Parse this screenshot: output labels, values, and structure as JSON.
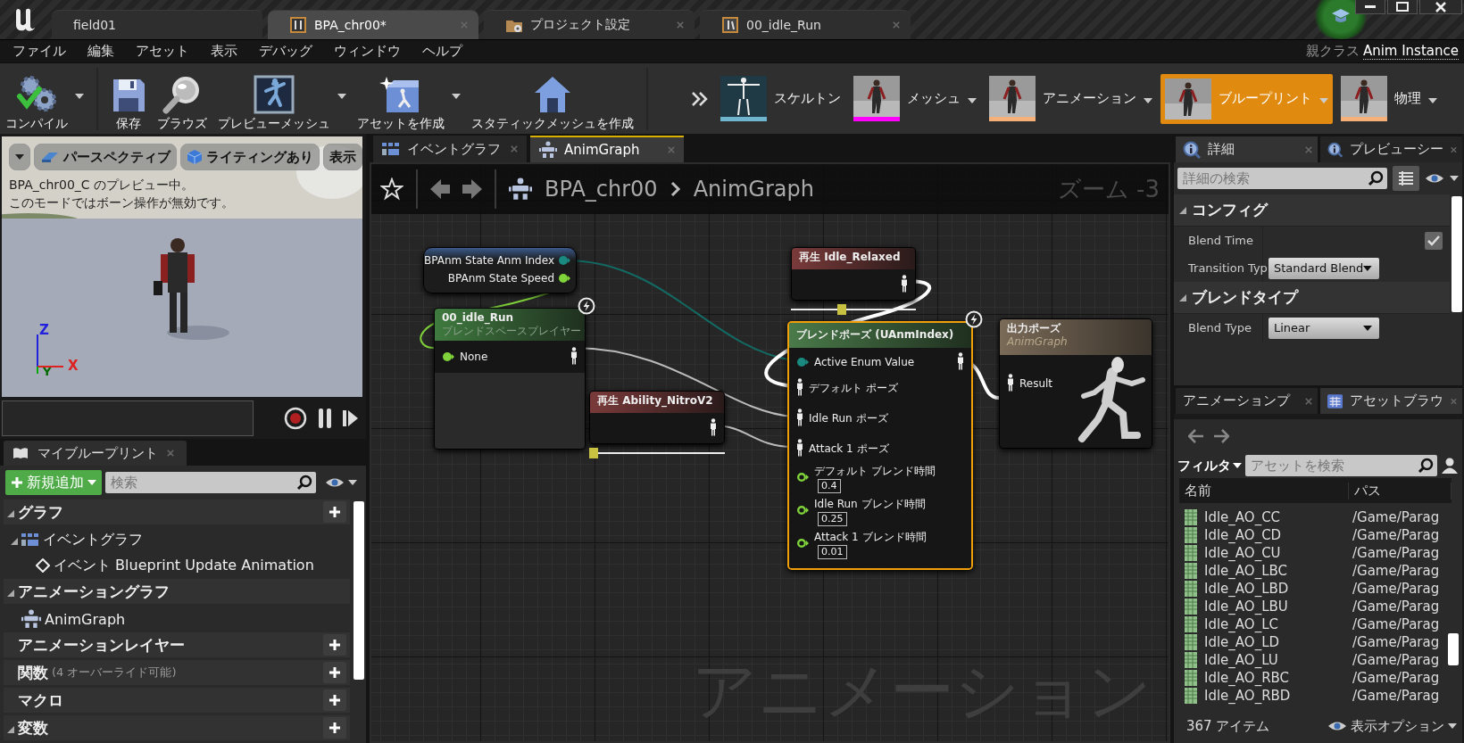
{
  "title_tabs": [
    {
      "label": "field01",
      "kind": "level",
      "selected": false
    },
    {
      "label": "BPA_chr00*",
      "kind": "blueprint",
      "selected": true
    },
    {
      "label": "プロジェクト設定",
      "kind": "settings",
      "selected": false
    },
    {
      "label": "00_idle_Run",
      "kind": "animation",
      "selected": false
    }
  ],
  "menu": [
    "ファイル",
    "編集",
    "アセット",
    "表示",
    "デバッグ",
    "ウィンドウ",
    "ヘルプ"
  ],
  "parent_class": {
    "label": "親クラス",
    "value": "Anim Instance"
  },
  "toolbar": [
    {
      "label": "コンパイル",
      "kind": "compile",
      "dropdown": true
    },
    {
      "label": "保存",
      "kind": "save",
      "dropdown": false
    },
    {
      "label": "ブラウズ",
      "kind": "browse",
      "dropdown": false
    },
    {
      "label": "プレビューメッシュ",
      "kind": "preview_mesh",
      "dropdown": true
    },
    {
      "label": "アセットを作成",
      "kind": "create_asset",
      "dropdown": true
    },
    {
      "label": "スタティックメッシュを作成",
      "kind": "static_mesh",
      "dropdown": false
    }
  ],
  "modes": [
    {
      "label": "スケルトン",
      "kind": "skeleton",
      "color": "#6fb5d0",
      "selected": false,
      "dropdown": false
    },
    {
      "label": "メッシュ",
      "kind": "mesh",
      "color": "#ff00ff",
      "selected": false,
      "dropdown": true
    },
    {
      "label": "アニメーション",
      "kind": "animation",
      "color": "#f5b07a",
      "selected": false,
      "dropdown": true
    },
    {
      "label": "ブループリント",
      "kind": "blueprint",
      "selected": true,
      "dropdown": true
    },
    {
      "label": "物理",
      "kind": "mesh",
      "color": "#f5b07a",
      "selected": false,
      "dropdown": true
    }
  ],
  "viewport": {
    "buttons": [
      {
        "label": "パースペクティブ",
        "kind": "perspective"
      },
      {
        "label": "ライティングあり",
        "kind": "lighting"
      },
      {
        "label": "表示",
        "kind": "plain"
      }
    ],
    "message": [
      "BPA_chr00_C のプレビュー中。",
      "このモードではボーン操作が無効です。"
    ],
    "axes": [
      "Z",
      "X",
      "Y"
    ]
  },
  "my_blueprint": {
    "tab": "マイブループリント",
    "add_button": "新規追加",
    "search_placeholder": "検索",
    "items": [
      {
        "label": "グラフ",
        "kind": "category",
        "expanded": true,
        "add": true,
        "children": [
          {
            "label": "イベントグラフ",
            "kind": "eventgraph",
            "expanded": true,
            "children": [
              {
                "label": "イベント Blueprint Update Animation",
                "kind": "event"
              }
            ]
          }
        ]
      },
      {
        "label": "アニメーショングラフ",
        "kind": "category",
        "expanded": true,
        "add": false,
        "children": [
          {
            "label": "AnimGraph",
            "kind": "animgraph"
          }
        ]
      },
      {
        "label": "アニメーションレイヤー",
        "kind": "category",
        "add": true
      },
      {
        "label": "関数",
        "note": "(4 オーバーライド可能)",
        "kind": "category",
        "add": true
      },
      {
        "label": "マクロ",
        "kind": "category",
        "add": true
      },
      {
        "label": "変数",
        "kind": "category",
        "expanded": true,
        "add": true
      }
    ]
  },
  "graph": {
    "tabs": [
      {
        "label": "イベントグラフ",
        "kind": "eventgraph",
        "selected": false
      },
      {
        "label": "AnimGraph",
        "kind": "animgraph",
        "selected": true
      }
    ],
    "breadcrumb": [
      "BPA_chr00",
      "AnimGraph"
    ],
    "zoom": "ズーム -3",
    "watermark": "アニメーション",
    "nodes": [
      {
        "kind": "variables",
        "pins": [
          {
            "label": "BPAnm State Anm Index",
            "kind": "enum",
            "connected": true
          },
          {
            "label": "BPAnm State Speed",
            "kind": "float",
            "connected": true
          }
        ]
      },
      {
        "kind": "blendspace",
        "title": "00_idle_Run",
        "subtitle": "ブレンドスペースプレイヤー",
        "fast_path": true,
        "inputs": [
          {
            "label": "None",
            "kind": "float",
            "connected": true
          }
        ]
      },
      {
        "kind": "sequence",
        "title": "再生 Ability_NitroV2",
        "level": 0
      },
      {
        "kind": "sequence",
        "title": "再生 Idle_Relaxed",
        "level": 0.4
      },
      {
        "kind": "blend",
        "title": "ブレンドポーズ (UAnmIndex)",
        "selected": true,
        "fast_path": true,
        "inputs": [
          {
            "label": "Active Enum Value",
            "kind": "enum",
            "connected": true
          },
          {
            "label": "デフォルト ポーズ",
            "kind": "pose",
            "connected": true
          },
          {
            "label": "Idle Run ポーズ",
            "kind": "pose",
            "connected": true
          },
          {
            "label": "Attack 1 ポーズ",
            "kind": "pose",
            "connected": true
          },
          {
            "label": "デフォルト ブレンド時間",
            "kind": "float",
            "connected": false,
            "value": "0.4"
          },
          {
            "label": "Idle Run ブレンド時間",
            "kind": "float",
            "connected": false,
            "value": "0.25"
          },
          {
            "label": "Attack 1 ブレンド時間",
            "kind": "float",
            "connected": false,
            "value": "0.01"
          }
        ]
      },
      {
        "kind": "output",
        "title": "出力ポーズ",
        "subtitle": "AnimGraph",
        "inputs": [
          {
            "label": "Result",
            "kind": "pose",
            "connected": true
          }
        ]
      }
    ]
  },
  "details": {
    "tabs": [
      {
        "label": "詳細",
        "selected": true
      },
      {
        "label": "プレビューシー",
        "selected": false
      }
    ],
    "search_placeholder": "詳細の検索",
    "sections": [
      {
        "title": "コンフィグ",
        "rows": [
          {
            "label": "Blend Time",
            "kind": "checkbox",
            "checked": true
          },
          {
            "label": "Transition Typ",
            "kind": "dropdown",
            "value": "Standard Blend"
          }
        ]
      },
      {
        "title": "ブレンドタイプ",
        "rows": [
          {
            "label": "Blend Type",
            "kind": "dropdown",
            "value": "Linear"
          }
        ]
      }
    ]
  },
  "asset_browser": {
    "tabs": [
      {
        "label": "アニメーションプ",
        "selected": false
      },
      {
        "label": "アセットブラウ",
        "selected": true
      }
    ],
    "filter": "フィルタ",
    "search_placeholder": "アセットを検索",
    "columns": [
      "名前",
      "パス"
    ],
    "rows": [
      {
        "name": "Idle_AO_CC",
        "path": "/Game/Parag"
      },
      {
        "name": "Idle_AO_CD",
        "path": "/Game/Parag"
      },
      {
        "name": "Idle_AO_CU",
        "path": "/Game/Parag"
      },
      {
        "name": "Idle_AO_LBC",
        "path": "/Game/Parag"
      },
      {
        "name": "Idle_AO_LBD",
        "path": "/Game/Parag"
      },
      {
        "name": "Idle_AO_LBU",
        "path": "/Game/Parag"
      },
      {
        "name": "Idle_AO_LC",
        "path": "/Game/Parag"
      },
      {
        "name": "Idle_AO_LD",
        "path": "/Game/Parag"
      },
      {
        "name": "Idle_AO_LU",
        "path": "/Game/Parag"
      },
      {
        "name": "Idle_AO_RBC",
        "path": "/Game/Parag"
      },
      {
        "name": "Idle_AO_RBD",
        "path": "/Game/Parag"
      }
    ],
    "count": "367 アイテム",
    "view_options": "表示オプション"
  }
}
